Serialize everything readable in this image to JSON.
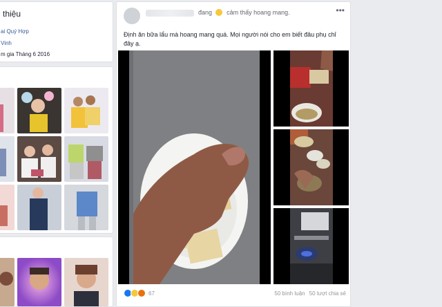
{
  "intro": {
    "title": "thiệu",
    "lines": [
      "ai Quý Hợp",
      "Vinh",
      "m gia Tháng 6 2016"
    ]
  },
  "friends": {
    "header": ""
  },
  "post": {
    "status_word": "đang",
    "feeling": "cảm thấy hoang mang.",
    "caption": "Định ăn bữa lẩu mà hoang mang quá. Mọi người nói cho em biết đâu phụ chỉ đây ạ.",
    "reaction_count": "67",
    "comments": "50 bình luận",
    "shares": "50 lượt chia sẻ",
    "more_icon": "more-icon"
  },
  "colors": {
    "link": "#365899",
    "page_bg": "#e9ebee",
    "meta": "#90949c",
    "like": "#1877f2",
    "haha": "#f7c83a",
    "angry": "#e9710f"
  }
}
